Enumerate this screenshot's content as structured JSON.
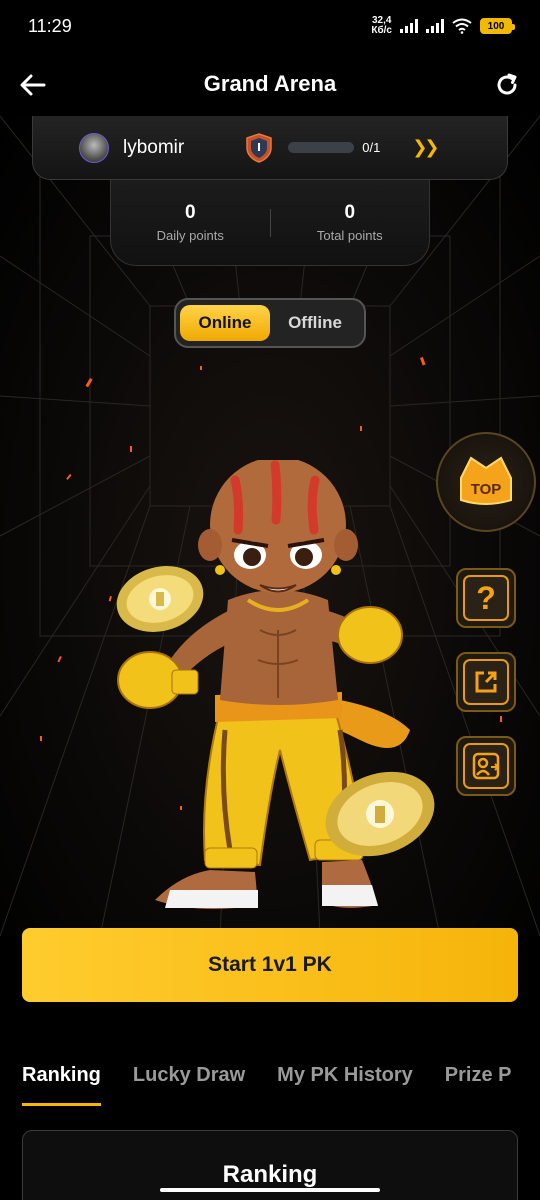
{
  "status_bar": {
    "time": "11:29",
    "net_speed_value": "32,4",
    "net_speed_unit": "Кб/с",
    "battery": "100"
  },
  "header": {
    "title": "Grand Arena"
  },
  "player": {
    "username": "lybomir",
    "progress_text": "0/1",
    "progress_fraction": 0
  },
  "points": {
    "daily_value": "0",
    "daily_label": "Daily points",
    "total_value": "0",
    "total_label": "Total points"
  },
  "mode": {
    "online": "Online",
    "offline": "Offline",
    "selected": "Online"
  },
  "side_buttons": {
    "top_label": "TOP",
    "help_icon": "question-icon",
    "share_icon": "share-icon",
    "switch_icon": "user-switch-icon"
  },
  "cta": {
    "label": "Start 1v1 PK"
  },
  "tabs": [
    {
      "label": "Ranking"
    },
    {
      "label": "Lucky Draw"
    },
    {
      "label": "My PK History"
    },
    {
      "label": "Prize P"
    }
  ],
  "ranking_section": {
    "title": "Ranking"
  },
  "colors": {
    "accent": "#F5B700",
    "background": "#000000"
  }
}
